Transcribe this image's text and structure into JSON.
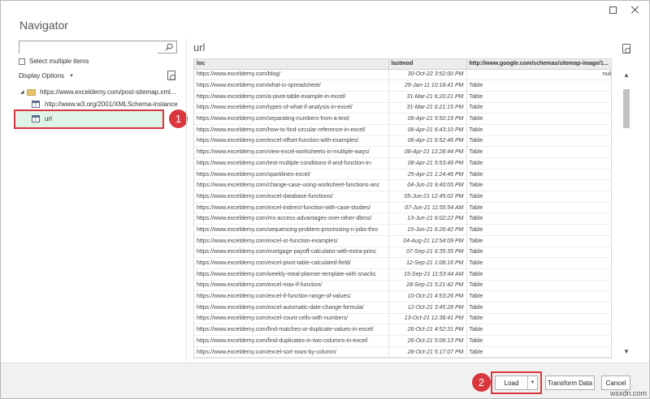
{
  "dialog": {
    "title": "Navigator"
  },
  "left": {
    "search_value": "",
    "select_multiple_label": "Select multiple items",
    "display_options_label": "Display Options",
    "tree": [
      {
        "label": "https://www.exceldemy.com/post-sitemap.xml...",
        "type": "folder",
        "expanded": true
      },
      {
        "label": "http://www.w3.org/2001/XMLSchema-instance",
        "type": "table"
      },
      {
        "label": "url",
        "type": "table",
        "selected": true
      }
    ]
  },
  "preview": {
    "title": "url",
    "columns": [
      "loc",
      "lastmod",
      "http://www.google.com/schemas/sitemap-image/1..."
    ],
    "rows": [
      [
        "https://www.exceldemy.com/blog/",
        "30-Oct-22 3:52:00 PM",
        "null"
      ],
      [
        "https://www.exceldemy.com/what-is-spreadsheet/",
        "29-Jan-11 10:18:41 PM",
        "Table"
      ],
      [
        "https://www.exceldemy.com/a-pivot-table-example-in-excel/",
        "31-Mar-21 6:20:21 PM",
        "Table"
      ],
      [
        "https://www.exceldemy.com/types-of-what-if-analysis-in-excel/",
        "31-Mar-21 6:21:15 PM",
        "Table"
      ],
      [
        "https://www.exceldemy.com/separating-numbers-from-a-text/",
        "06-Apr-21 5:50:19 PM",
        "Table"
      ],
      [
        "https://www.exceldemy.com/how-to-find-circular-reference-in-excel/",
        "06-Apr-21 6:43:10 PM",
        "Table"
      ],
      [
        "https://www.exceldemy.com/excel-offset-function-with-examples/",
        "06-Apr-21 6:52:46 PM",
        "Table"
      ],
      [
        "https://www.exceldemy.com/view-excel-worksheets-in-multiple-ways/",
        "08-Apr-21 12:28:44 PM",
        "Table"
      ],
      [
        "https://www.exceldemy.com/test-multiple-conditions-if-and-function-in-",
        "08-Apr-21 5:53:49 PM",
        "Table"
      ],
      [
        "https://www.exceldemy.com/sparklines-excel/",
        "25-Apr-21 1:24:46 PM",
        "Table"
      ],
      [
        "https://www.exceldemy.com/change-case-using-worksheet-functions-anc",
        "04-Jun-21 9:40:05 PM",
        "Table"
      ],
      [
        "https://www.exceldemy.com/excel-database-functions/",
        "05-Jun-21 12:45:02 PM",
        "Table"
      ],
      [
        "https://www.exceldemy.com/excel-indirect-function-with-case-studies/",
        "07-Jun-21 11:55:54 AM",
        "Table"
      ],
      [
        "https://www.exceldemy.com/ms-access-advantages-over-other-dbms/",
        "13-Jun-21 6:02:22 PM",
        "Table"
      ],
      [
        "https://www.exceldemy.com/sequencing-problem-processing-n-jobs-thro",
        "15-Jun-21 6:26:42 PM",
        "Table"
      ],
      [
        "https://www.exceldemy.com/excel-or-function-examples/",
        "04-Aug-21 12:54:09 PM",
        "Table"
      ],
      [
        "https://www.exceldemy.com/mortgage-payoff-calculator-with-extra-princ",
        "07-Sep-21 6:35:35 PM",
        "Table"
      ],
      [
        "https://www.exceldemy.com/excel-pivot-table-calculated-field/",
        "12-Sep-21 1:08:16 PM",
        "Table"
      ],
      [
        "https://www.exceldemy.com/weekly-meal-planner-template-with-snacks",
        "15-Sep-21 11:53:44 AM",
        "Table"
      ],
      [
        "https://www.exceldemy.com/excel-max-if-function/",
        "28-Sep-21 5:21:42 PM",
        "Table"
      ],
      [
        "https://www.exceldemy.com/excel-if-function-range-of-values/",
        "10-Oct-21 4:53:26 PM",
        "Table"
      ],
      [
        "https://www.exceldemy.com/excel-automatic-date-change-formula/",
        "12-Oct-21 3:45:28 PM",
        "Table"
      ],
      [
        "https://www.exceldemy.com/excel-count-cells-with-numbers/",
        "13-Oct-21 12:38:41 PM",
        "Table"
      ],
      [
        "https://www.exceldemy.com/find-matches-or-duplicate-values-in-excel/",
        "26-Oct-21 4:52:31 PM",
        "Table"
      ],
      [
        "https://www.exceldemy.com/find-duplicates-in-two-columns-in-excel/",
        "26-Oct-21 5:06:13 PM",
        "Table"
      ],
      [
        "https://www.exceldemy.com/excel-sort-rows-by-column/",
        "28-Oct-21 5:17:07 PM",
        "Table"
      ]
    ]
  },
  "footer": {
    "load_label": "Load",
    "transform_label": "Transform Data",
    "cancel_label": "Cancel"
  },
  "annotations": {
    "badge1": "1",
    "badge2": "2"
  },
  "watermark": "wsxdn.com",
  "colors": {
    "highlight_red": "#d9363e",
    "selected_row": "#dff3e6"
  }
}
